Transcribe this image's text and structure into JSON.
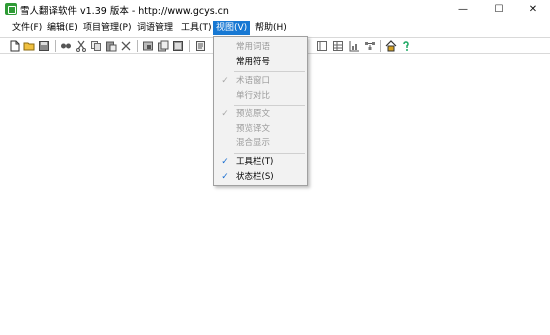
{
  "window": {
    "title": "雪人翻译软件 v1.39 版本 - http://www.gcys.cn",
    "minimize_glyph": "—",
    "maximize_glyph": "☐",
    "close_glyph": "✕"
  },
  "menubar": {
    "items": [
      {
        "label": "文件(F)"
      },
      {
        "label": "编辑(E)"
      },
      {
        "label": "项目管理(P)"
      },
      {
        "label": "词语管理"
      },
      {
        "label": "工具(T)"
      },
      {
        "label": "视图(V)"
      },
      {
        "label": "帮助(H)"
      }
    ],
    "active_index": 5
  },
  "toolbar": {
    "icons": [
      "new-file-icon",
      "open-folder-icon",
      "save-icon",
      "find-icon",
      "cut-icon",
      "copy-icon",
      "paste-icon",
      "delete-icon",
      "record-icon",
      "doc-icon",
      "doc-stack-icon",
      "edit-icon",
      "panel-icon",
      "table-icon",
      "chart-icon",
      "diagram-icon",
      "home-icon",
      "help-icon"
    ]
  },
  "view_menu": {
    "items": [
      {
        "label": "常用词语",
        "checked": false,
        "enabled": false
      },
      {
        "label": "常用符号",
        "checked": false,
        "enabled": true
      },
      {
        "label": "术语窗口",
        "checked": true,
        "enabled": false
      },
      {
        "label": "单行对比",
        "checked": false,
        "enabled": false
      },
      {
        "label": "预览原文",
        "checked": true,
        "enabled": false
      },
      {
        "label": "预览译文",
        "checked": false,
        "enabled": false
      },
      {
        "label": "混合显示",
        "checked": false,
        "enabled": false
      },
      {
        "label": "工具栏(T)",
        "checked": true,
        "enabled": true
      },
      {
        "label": "状态栏(S)",
        "checked": true,
        "enabled": true
      }
    ],
    "check_glyph": "✓"
  },
  "colors": {
    "menu_active_bg": "#1778d3",
    "app_icon": "#2e9b35",
    "check_enabled": "#1a6fd0"
  }
}
